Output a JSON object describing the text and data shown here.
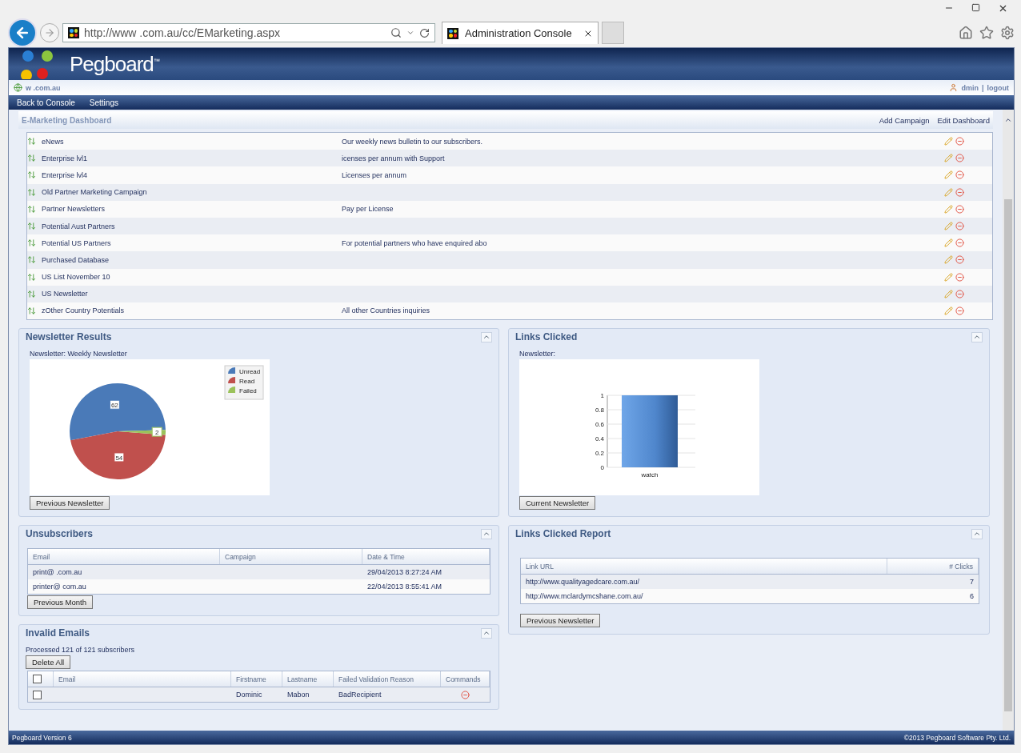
{
  "browser": {
    "address": "http://www .com.au/cc/EMarketing.aspx",
    "tab_title": "Administration Console"
  },
  "header": {
    "brand": "Pegboard$^{™}$"
  },
  "user_bar": {
    "site": "w .com.au",
    "user": "dmin",
    "separator": "|",
    "logout": "logout"
  },
  "nav": [
    "Back to Console",
    "Settings"
  ],
  "dashboard": {
    "title": "E-Marketing Dashboard",
    "actions": [
      "Add Campaign",
      "Edit Dashboard"
    ]
  },
  "campaigns": [
    {
      "name": "eNews",
      "description": "Our weekly news bulletin to our subscribers."
    },
    {
      "name": "Enterprise lvl1",
      "description": "icenses per annum with Support"
    },
    {
      "name": "Enterprise lvl4",
      "description": "Licenses per annum"
    },
    {
      "name": "Old Partner Marketing Campaign"
    },
    {
      "name": "Partner Newsletters",
      "description": "Pay per License"
    },
    {
      "name": "Potential Aust Partners"
    },
    {
      "name": "Potential US Partners",
      "description": "For potential partners who have enquired abo"
    },
    {
      "name": "Purchased Database"
    },
    {
      "name": "US List November 10"
    },
    {
      "name": "US Newsletter"
    },
    {
      "name": "zOther Country Potentials",
      "description": "All other Countries inquiries"
    }
  ],
  "newsletter_results": {
    "title": "Newsletter Results",
    "subtitle": "Newsletter: Weekly Newsletter",
    "button": "Previous Newsletter",
    "chart_data": {
      "type": "pie",
      "categories": [
        "Unread",
        "Read",
        "Failed"
      ],
      "values": [
        62,
        54,
        2
      ],
      "colors": [
        "#4a7ab8",
        "#c0504d",
        "#9bc25a"
      ],
      "data_labels": true,
      "legend": "upper right"
    }
  },
  "links_clicked": {
    "title": "Links Clicked",
    "subtitle": "Newsletter:",
    "button": "Current Newsletter",
    "chart_data": {
      "type": "bar",
      "categories": [
        "watch"
      ],
      "values": [
        1
      ],
      "ylim": [
        0,
        1
      ],
      "grid": true,
      "yticks": [
        0,
        0.2,
        0.4,
        0.6,
        0.8,
        1
      ]
    }
  },
  "unsubscribers": {
    "title": "Unsubscribers",
    "columns": [
      "Email",
      "Campaign",
      "Date & Time"
    ],
    "button": "Previous Month",
    "rows": [
      {
        "email": "print@ .com.au",
        "date": "29/04/2013 8:27:24 AM"
      },
      {
        "email": "printer@ com.au",
        "date": "22/04/2013 8:55:41 AM"
      }
    ]
  },
  "links_report": {
    "title": "Links Clicked Report",
    "columns": [
      "Link URL",
      "# Clicks"
    ],
    "button": "Previous Newsletter",
    "rows": [
      {
        "url": "http://www.qualityagedcare.com.au/",
        "clicks": "7"
      },
      {
        "url": "http://www.mclardymcshane.com.au/",
        "clicks": "6"
      }
    ]
  },
  "invalid_emails": {
    "title": "Invalid Emails",
    "summary": "Processed 121 of 121 subscribers",
    "button": "Delete All",
    "all_checked": false,
    "columns": [
      "Email",
      "Firstname",
      "Lastname",
      "Failed Validation Reason",
      "Commands"
    ],
    "rows": [
      {
        "checked": false,
        "firstname": "Dominic",
        "lastname": "Mabon",
        "reason": "BadRecipient"
      }
    ]
  },
  "footer": {
    "left": "Pegboard Version 6",
    "right": "©2013 Pegboard Software Pty. Ltd."
  }
}
